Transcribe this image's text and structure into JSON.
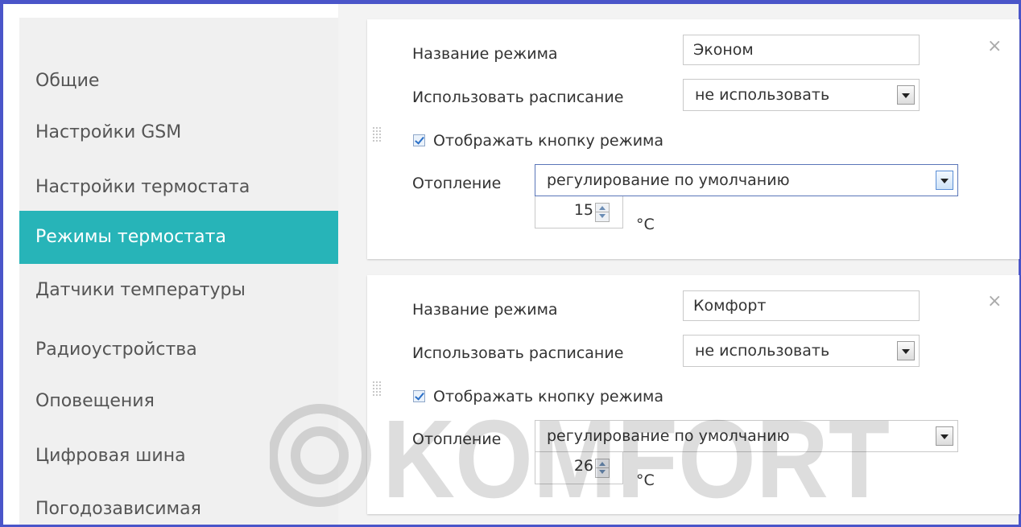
{
  "sidebar": {
    "items": [
      {
        "label": "Общие",
        "active": false
      },
      {
        "label": "Настройки GSM",
        "active": false
      },
      {
        "label": "Настройки термостата",
        "active": false
      },
      {
        "label": "Режимы термостата",
        "active": true
      },
      {
        "label": "Датчики температуры",
        "active": false
      },
      {
        "label": "Радиоустройства",
        "active": false
      },
      {
        "label": "Оповещения",
        "active": false
      },
      {
        "label": "Цифровая шина",
        "active": false
      },
      {
        "label": "Погодозависимая",
        "active": false
      }
    ]
  },
  "modes": [
    {
      "name_label": "Название режима",
      "name_value": "Эконом",
      "schedule_label": "Использовать расписание",
      "schedule_value": "не использовать",
      "show_button_label": "Отображать кнопку режима",
      "show_button_checked": true,
      "heating_label": "Отопление",
      "heating_value": "регулирование по умолчанию",
      "temperature": "15",
      "unit": "°C",
      "close_glyph": "×"
    },
    {
      "name_label": "Название режима",
      "name_value": "Комфорт",
      "schedule_label": "Использовать расписание",
      "schedule_value": "не использовать",
      "show_button_label": "Отображать кнопку режима",
      "show_button_checked": true,
      "heating_label": "Отопление",
      "heating_value": "регулирование по умолчанию",
      "temperature": "26",
      "unit": "°C",
      "close_glyph": "×"
    }
  ],
  "watermark": {
    "text": "KOMFORT"
  },
  "colors": {
    "frame": "#4a55c9",
    "active_item_bg": "#27b4b8",
    "sidebar_bg": "#f0f0f0"
  },
  "icons": {
    "close": "close-icon",
    "drag": "drag-handle-icon",
    "dropdown": "chevron-down-icon",
    "checkbox": "checkbox-checked-icon",
    "spinner": "spinner-arrows-icon"
  }
}
